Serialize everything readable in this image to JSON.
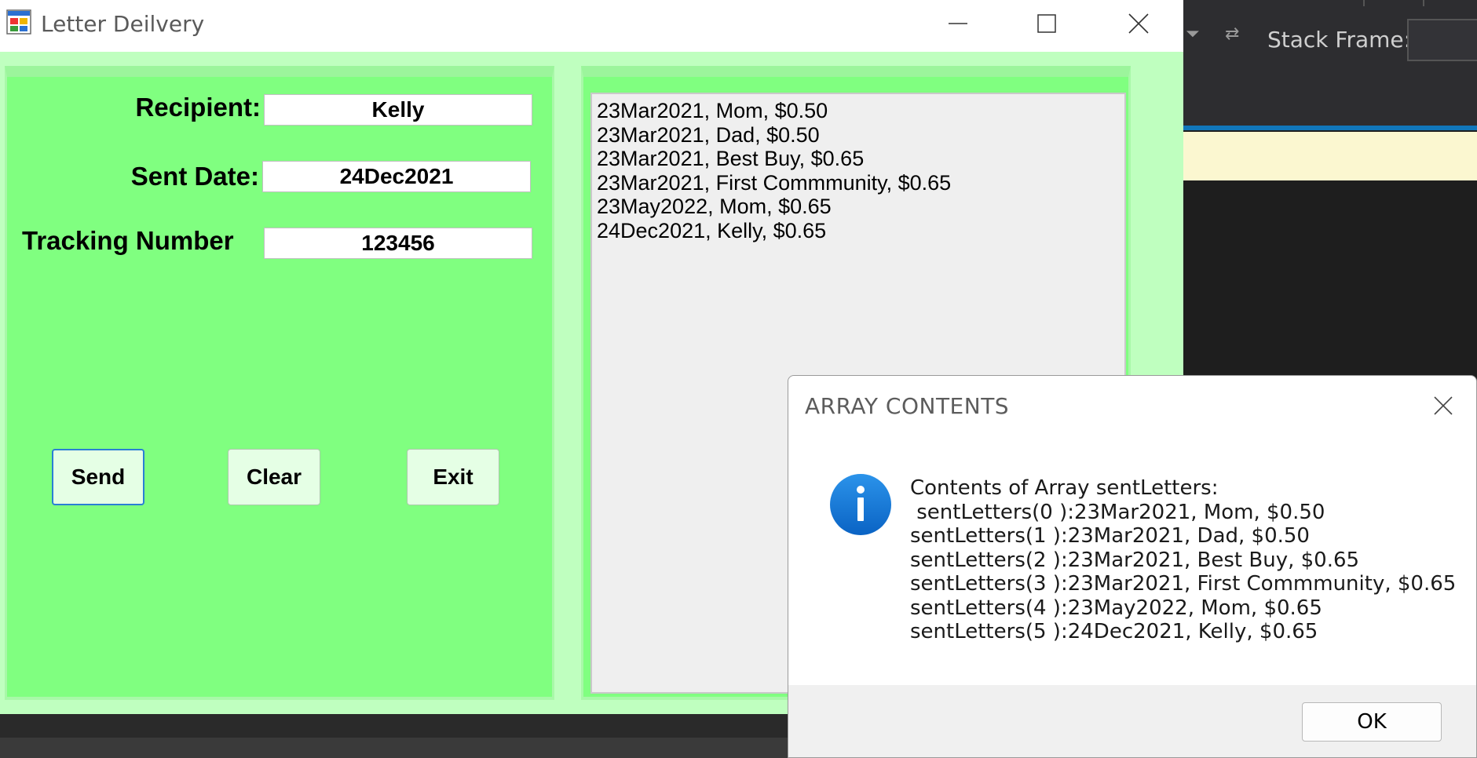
{
  "ide": {
    "stack_frame_label": "Stack Frame:"
  },
  "window": {
    "title": "Letter Deilvery",
    "icon": "winforms-app-icon",
    "controls": {
      "minimize": "minimize-icon",
      "maximize": "maximize-icon",
      "close": "close-icon"
    }
  },
  "form": {
    "recipient_label": "Recipient:",
    "recipient_value": "Kelly",
    "sent_date_label": "Sent Date:",
    "sent_date_value": "24Dec2021",
    "tracking_label": "Tracking Number",
    "tracking_value": "123456"
  },
  "buttons": {
    "send": "Send",
    "clear": "Clear",
    "exit": "Exit"
  },
  "letters_list": [
    "23Mar2021, Mom, $0.50",
    "23Mar2021, Dad, $0.50",
    "23Mar2021, Best Buy, $0.65",
    "23Mar2021, First Commmunity, $0.65",
    "23May2022, Mom, $0.65",
    "24Dec2021, Kelly, $0.65"
  ],
  "dialog": {
    "title": "ARRAY CONTENTS",
    "icon": "info-icon",
    "lines": [
      "Contents of Array sentLetters:",
      " sentLetters(0 ):23Mar2021, Mom, $0.50",
      "sentLetters(1 ):23Mar2021, Dad, $0.50",
      "sentLetters(2 ):23Mar2021, Best Buy, $0.65",
      "sentLetters(3 ):23Mar2021, First Commmunity, $0.65",
      "sentLetters(4 ):23May2022, Mom, $0.65",
      "sentLetters(5 ):24Dec2021, Kelly, $0.65"
    ],
    "ok_label": "OK"
  },
  "colors": {
    "form_green": "#80ff80",
    "client_light_green": "#bfffbf",
    "button_bg": "#e5ffe5",
    "focus_blue": "#2a7fd4",
    "info_blue": "#1a7fd8"
  }
}
